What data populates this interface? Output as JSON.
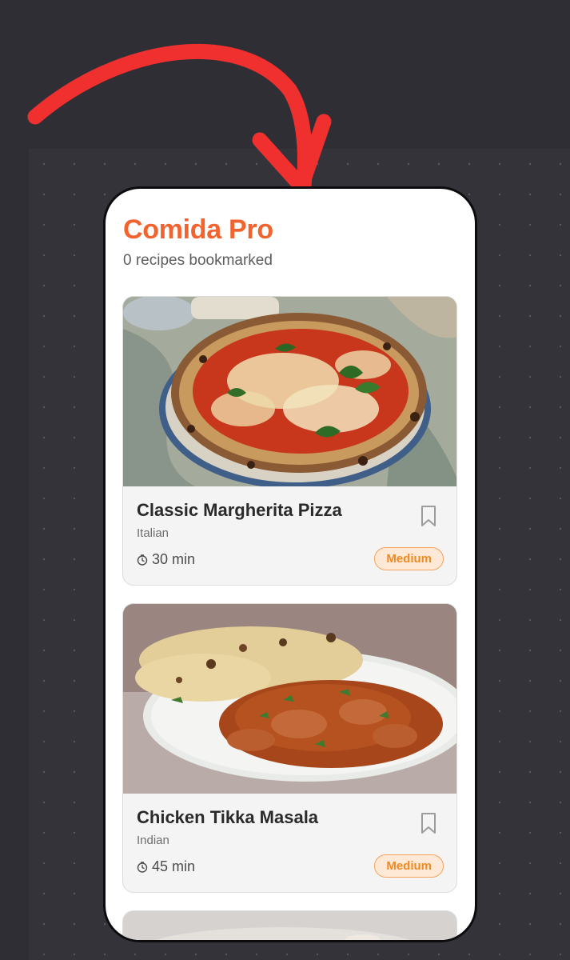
{
  "app": {
    "title": "Comida Pro",
    "subtitle": "0 recipes bookmarked"
  },
  "recipes": [
    {
      "title": "Classic Margherita Pizza",
      "cuisine": "Italian",
      "time": "30 min",
      "difficulty": "Medium",
      "bookmarked": false,
      "image": "pizza-photo"
    },
    {
      "title": "Chicken Tikka Masala",
      "cuisine": "Indian",
      "time": "45 min",
      "difficulty": "Medium",
      "bookmarked": false,
      "image": "curry-photo"
    }
  ],
  "colors": {
    "accent": "#f2642f",
    "badge_text": "#ef8a22",
    "badge_bg": "#fde9d6",
    "annotation_arrow": "#f0302f",
    "page_bg": "#2f2e34"
  },
  "icons": [
    "bookmark-icon",
    "clock-icon",
    "arrow-annotation"
  ]
}
